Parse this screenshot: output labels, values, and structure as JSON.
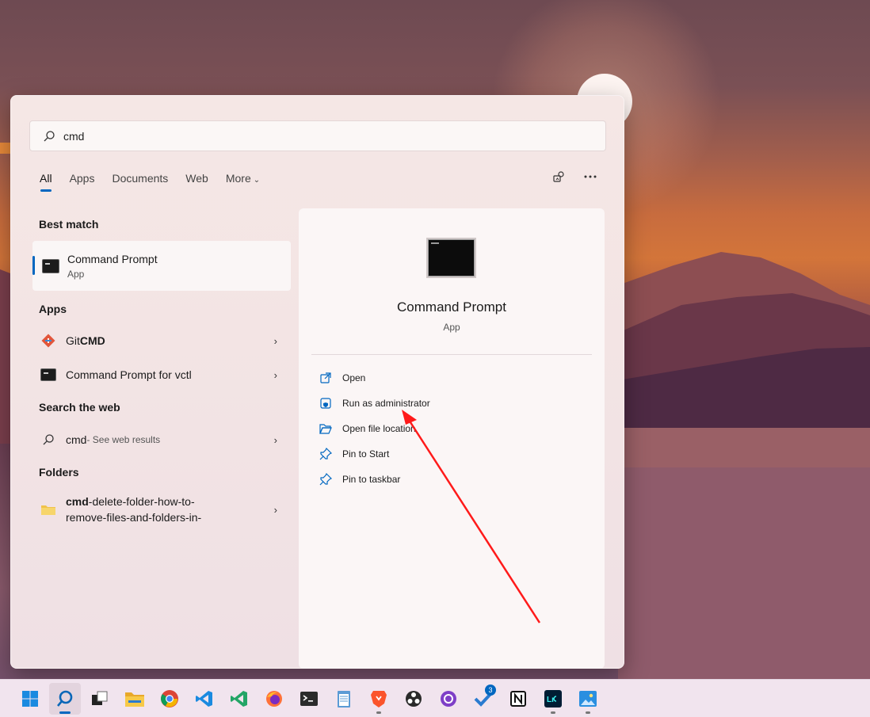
{
  "search": {
    "value": "cmd"
  },
  "tabs": [
    {
      "label": "All"
    },
    {
      "label": "Apps"
    },
    {
      "label": "Documents"
    },
    {
      "label": "Web"
    },
    {
      "label": "More"
    }
  ],
  "sections": {
    "best_match": "Best match",
    "apps": "Apps",
    "search_web": "Search the web",
    "folders": "Folders"
  },
  "best_match": {
    "title": "Command Prompt",
    "subtitle": "App"
  },
  "apps": [
    {
      "label_bold": "CMD",
      "label_prefix": "Git ",
      "icon": "git-icon"
    },
    {
      "label": "Command Prompt for vctl",
      "icon": "cmd-icon"
    }
  ],
  "web": {
    "query": "cmd",
    "suffix": " - See web results"
  },
  "folders": [
    {
      "bold": "cmd",
      "line1_rest": "-delete-folder-how-to-",
      "line2": "remove-files-and-folders-in-"
    }
  ],
  "detail": {
    "title": "Command Prompt",
    "subtitle": "App",
    "actions": [
      {
        "label": "Open",
        "icon": "open-external-icon"
      },
      {
        "label": "Run as administrator",
        "icon": "shield-icon"
      },
      {
        "label": "Open file location",
        "icon": "folder-open-icon"
      },
      {
        "label": "Pin to Start",
        "icon": "pin-icon"
      },
      {
        "label": "Pin to taskbar",
        "icon": "pin-icon"
      }
    ]
  },
  "taskbar": {
    "badge_count": "3",
    "items": [
      "windows-start-icon",
      "search-icon",
      "task-view-icon",
      "file-explorer-icon",
      "chrome-icon",
      "vscode-icon",
      "visual-studio-icon",
      "firefox-icon",
      "terminal-icon",
      "notepad-icon",
      "brave-icon",
      "obs-icon",
      "github-desktop-icon",
      "todo-icon",
      "notion-icon",
      "lightroom-icon",
      "photos-icon"
    ]
  },
  "colors": {
    "accent": "#0067c0",
    "annotation": "#ff1a1a"
  }
}
